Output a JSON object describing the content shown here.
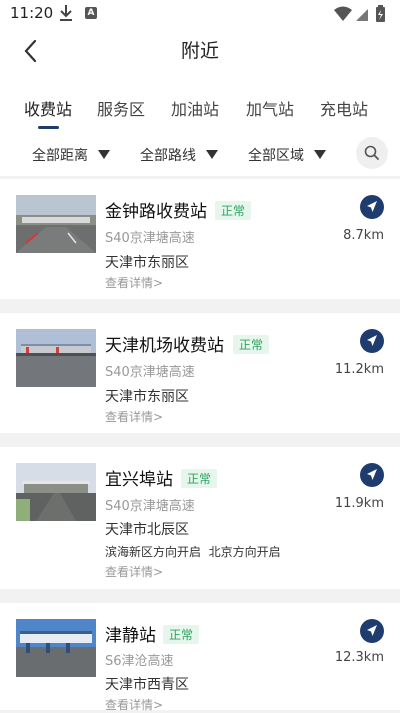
{
  "status_bar": {
    "time": "11:20",
    "notification_icon": "A"
  },
  "header": {
    "title": "附近"
  },
  "tabs": [
    {
      "label": "收费站",
      "active": true
    },
    {
      "label": "服务区"
    },
    {
      "label": "加油站"
    },
    {
      "label": "加气站"
    },
    {
      "label": "充电站"
    }
  ],
  "filters": [
    {
      "label": "全部距离"
    },
    {
      "label": "全部路线"
    },
    {
      "label": "全部区域"
    }
  ],
  "items": [
    {
      "name": "金钟路收费站",
      "status": "正常",
      "road": "S40京津塘高速",
      "district": "天津市东丽区",
      "directions": "",
      "details": "查看详情>",
      "distance": "8.7km"
    },
    {
      "name": "天津机场收费站",
      "status": "正常",
      "road": "S40京津塘高速",
      "district": "天津市东丽区",
      "directions": "",
      "details": "查看详情>",
      "distance": "11.2km"
    },
    {
      "name": "宜兴埠站",
      "status": "正常",
      "road": "S40京津塘高速",
      "district": "天津市北辰区",
      "directions": "滨海新区方向开启  北京方向开启",
      "details": "查看详情>",
      "distance": "11.9km"
    },
    {
      "name": "津静站",
      "status": "正常",
      "road": "S6津沧高速",
      "district": "天津市西青区",
      "directions": "",
      "details": "查看详情>",
      "distance": "12.3km"
    }
  ],
  "colors": {
    "accent": "#1f3c6e",
    "status_green": "#2ea260",
    "badge_bg": "#e6f6ec"
  }
}
